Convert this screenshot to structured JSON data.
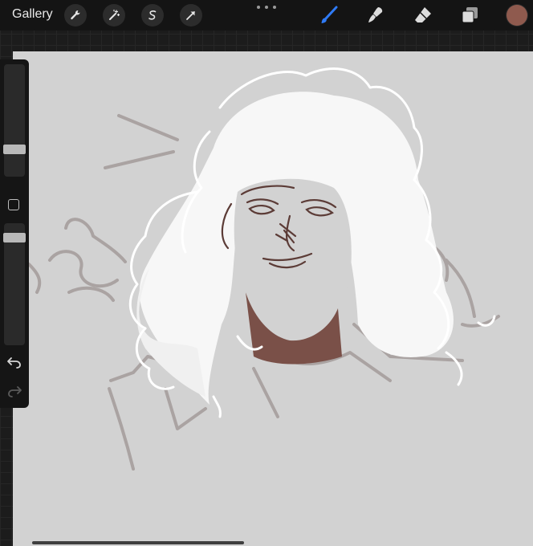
{
  "topbar": {
    "gallery_label": "Gallery",
    "left_tools": [
      "wrench-icon",
      "magic-wand-icon",
      "selection-icon",
      "transform-arrow-icon"
    ],
    "right_tools": [
      "brush-icon",
      "smudge-icon",
      "eraser-icon",
      "layers-icon"
    ],
    "active_tool": "brush-icon",
    "current_color": "#8f5a4e",
    "accent_color": "#2f7bf6"
  },
  "sidebar": {
    "controls": [
      "brush-size-slider",
      "modify-button",
      "opacity-slider",
      "undo-icon",
      "redo-icon"
    ]
  },
  "canvas": {
    "background_color": "#d2d2d2",
    "artwork": "sketch-portrait"
  }
}
